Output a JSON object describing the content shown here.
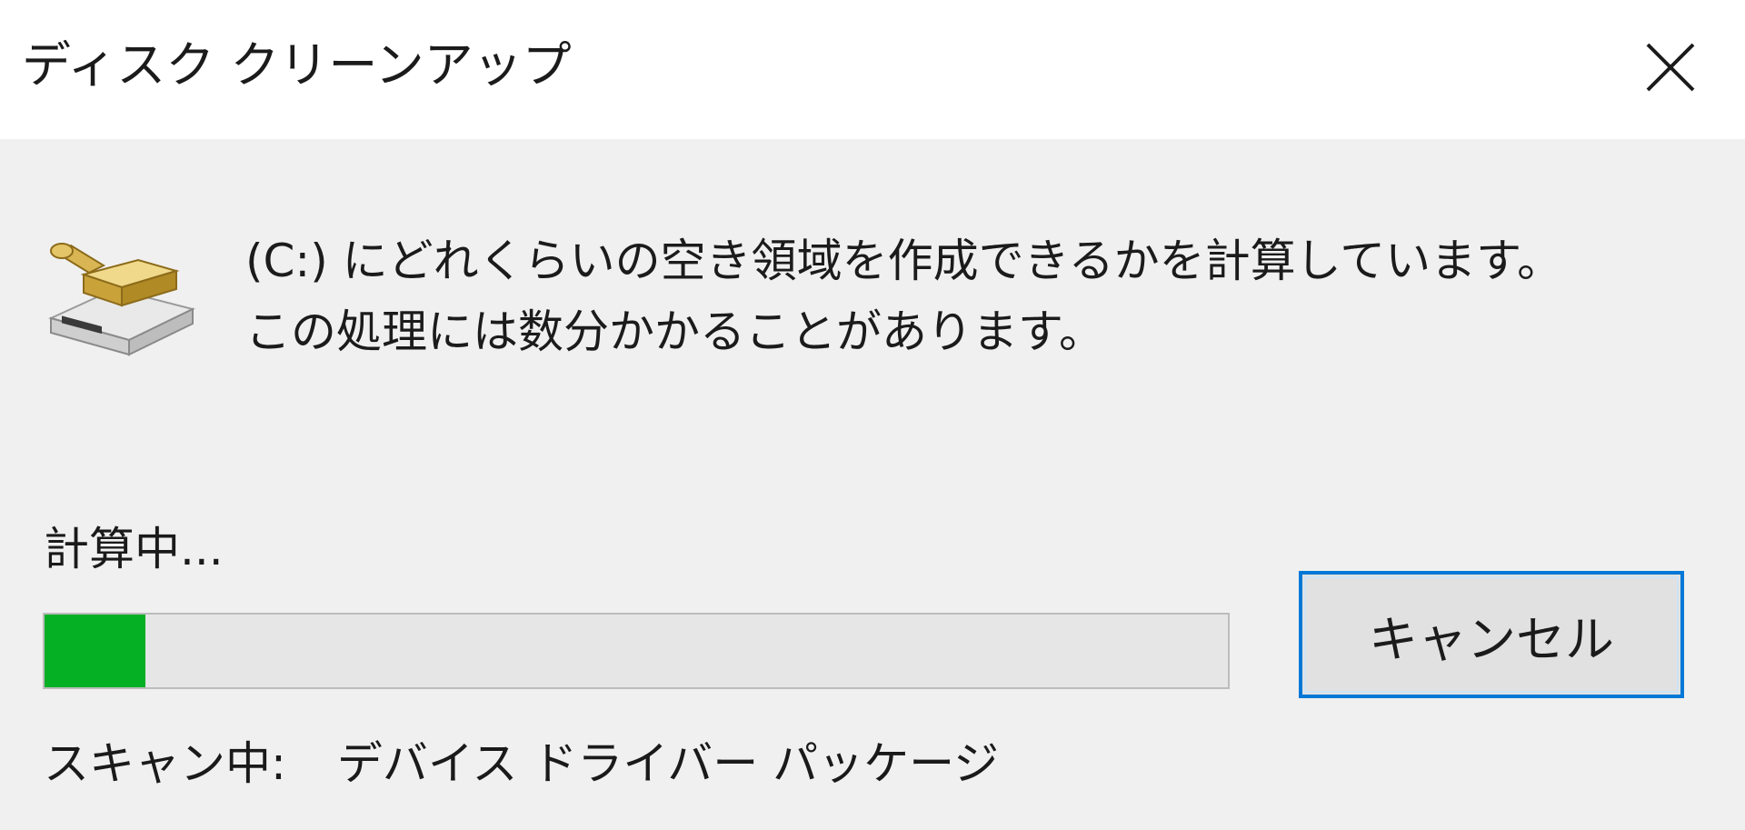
{
  "window": {
    "title": "ディスク クリーンアップ",
    "close_icon": "close-icon"
  },
  "message": {
    "line1": "(C:) にどれくらいの空き領域を作成できるかを計算しています。",
    "line2": "この処理には数分かかることがあります。"
  },
  "app_icon": "disk-cleanup-broom-drive-icon",
  "status": {
    "label": "計算中...",
    "progress_fraction": 0.085,
    "progress_color": "#06b025",
    "scan_prefix": "スキャン中:",
    "scan_item": "デバイス ドライバー パッケージ"
  },
  "buttons": {
    "cancel_label": "キャンセル",
    "focus_color": "#0078d7"
  }
}
